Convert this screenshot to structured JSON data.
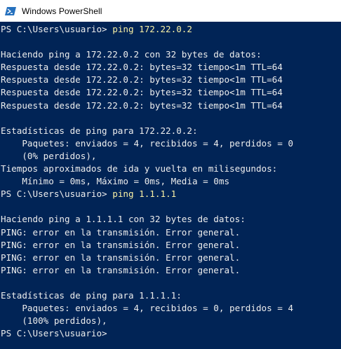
{
  "window": {
    "title": "Windows PowerShell",
    "icon": "powershell-icon",
    "background_color": "#012456",
    "text_color": "#ededed",
    "command_color": "#f9f1a5"
  },
  "console": {
    "lines": [
      {
        "text": "PS C:\\Users\\usuario> ",
        "cmd": "ping 172.22.0.2"
      },
      {
        "text": ""
      },
      {
        "text": "Haciendo ping a 172.22.0.2 con 32 bytes de datos:"
      },
      {
        "text": "Respuesta desde 172.22.0.2: bytes=32 tiempo<1m TTL=64"
      },
      {
        "text": "Respuesta desde 172.22.0.2: bytes=32 tiempo<1m TTL=64"
      },
      {
        "text": "Respuesta desde 172.22.0.2: bytes=32 tiempo<1m TTL=64"
      },
      {
        "text": "Respuesta desde 172.22.0.2: bytes=32 tiempo<1m TTL=64"
      },
      {
        "text": ""
      },
      {
        "text": "Estadísticas de ping para 172.22.0.2:"
      },
      {
        "text": "    Paquetes: enviados = 4, recibidos = 4, perdidos = 0"
      },
      {
        "text": "    (0% perdidos),"
      },
      {
        "text": "Tiempos aproximados de ida y vuelta en milisegundos:"
      },
      {
        "text": "    Mínimo = 0ms, Máximo = 0ms, Media = 0ms"
      },
      {
        "text": "PS C:\\Users\\usuario> ",
        "cmd": "ping 1.1.1.1"
      },
      {
        "text": ""
      },
      {
        "text": "Haciendo ping a 1.1.1.1 con 32 bytes de datos:"
      },
      {
        "text": "PING: error en la transmisión. Error general."
      },
      {
        "text": "PING: error en la transmisión. Error general."
      },
      {
        "text": "PING: error en la transmisión. Error general."
      },
      {
        "text": "PING: error en la transmisión. Error general."
      },
      {
        "text": ""
      },
      {
        "text": "Estadísticas de ping para 1.1.1.1:"
      },
      {
        "text": "    Paquetes: enviados = 4, recibidos = 0, perdidos = 4"
      },
      {
        "text": "    (100% perdidos),"
      },
      {
        "text": "PS C:\\Users\\usuario>"
      }
    ]
  }
}
